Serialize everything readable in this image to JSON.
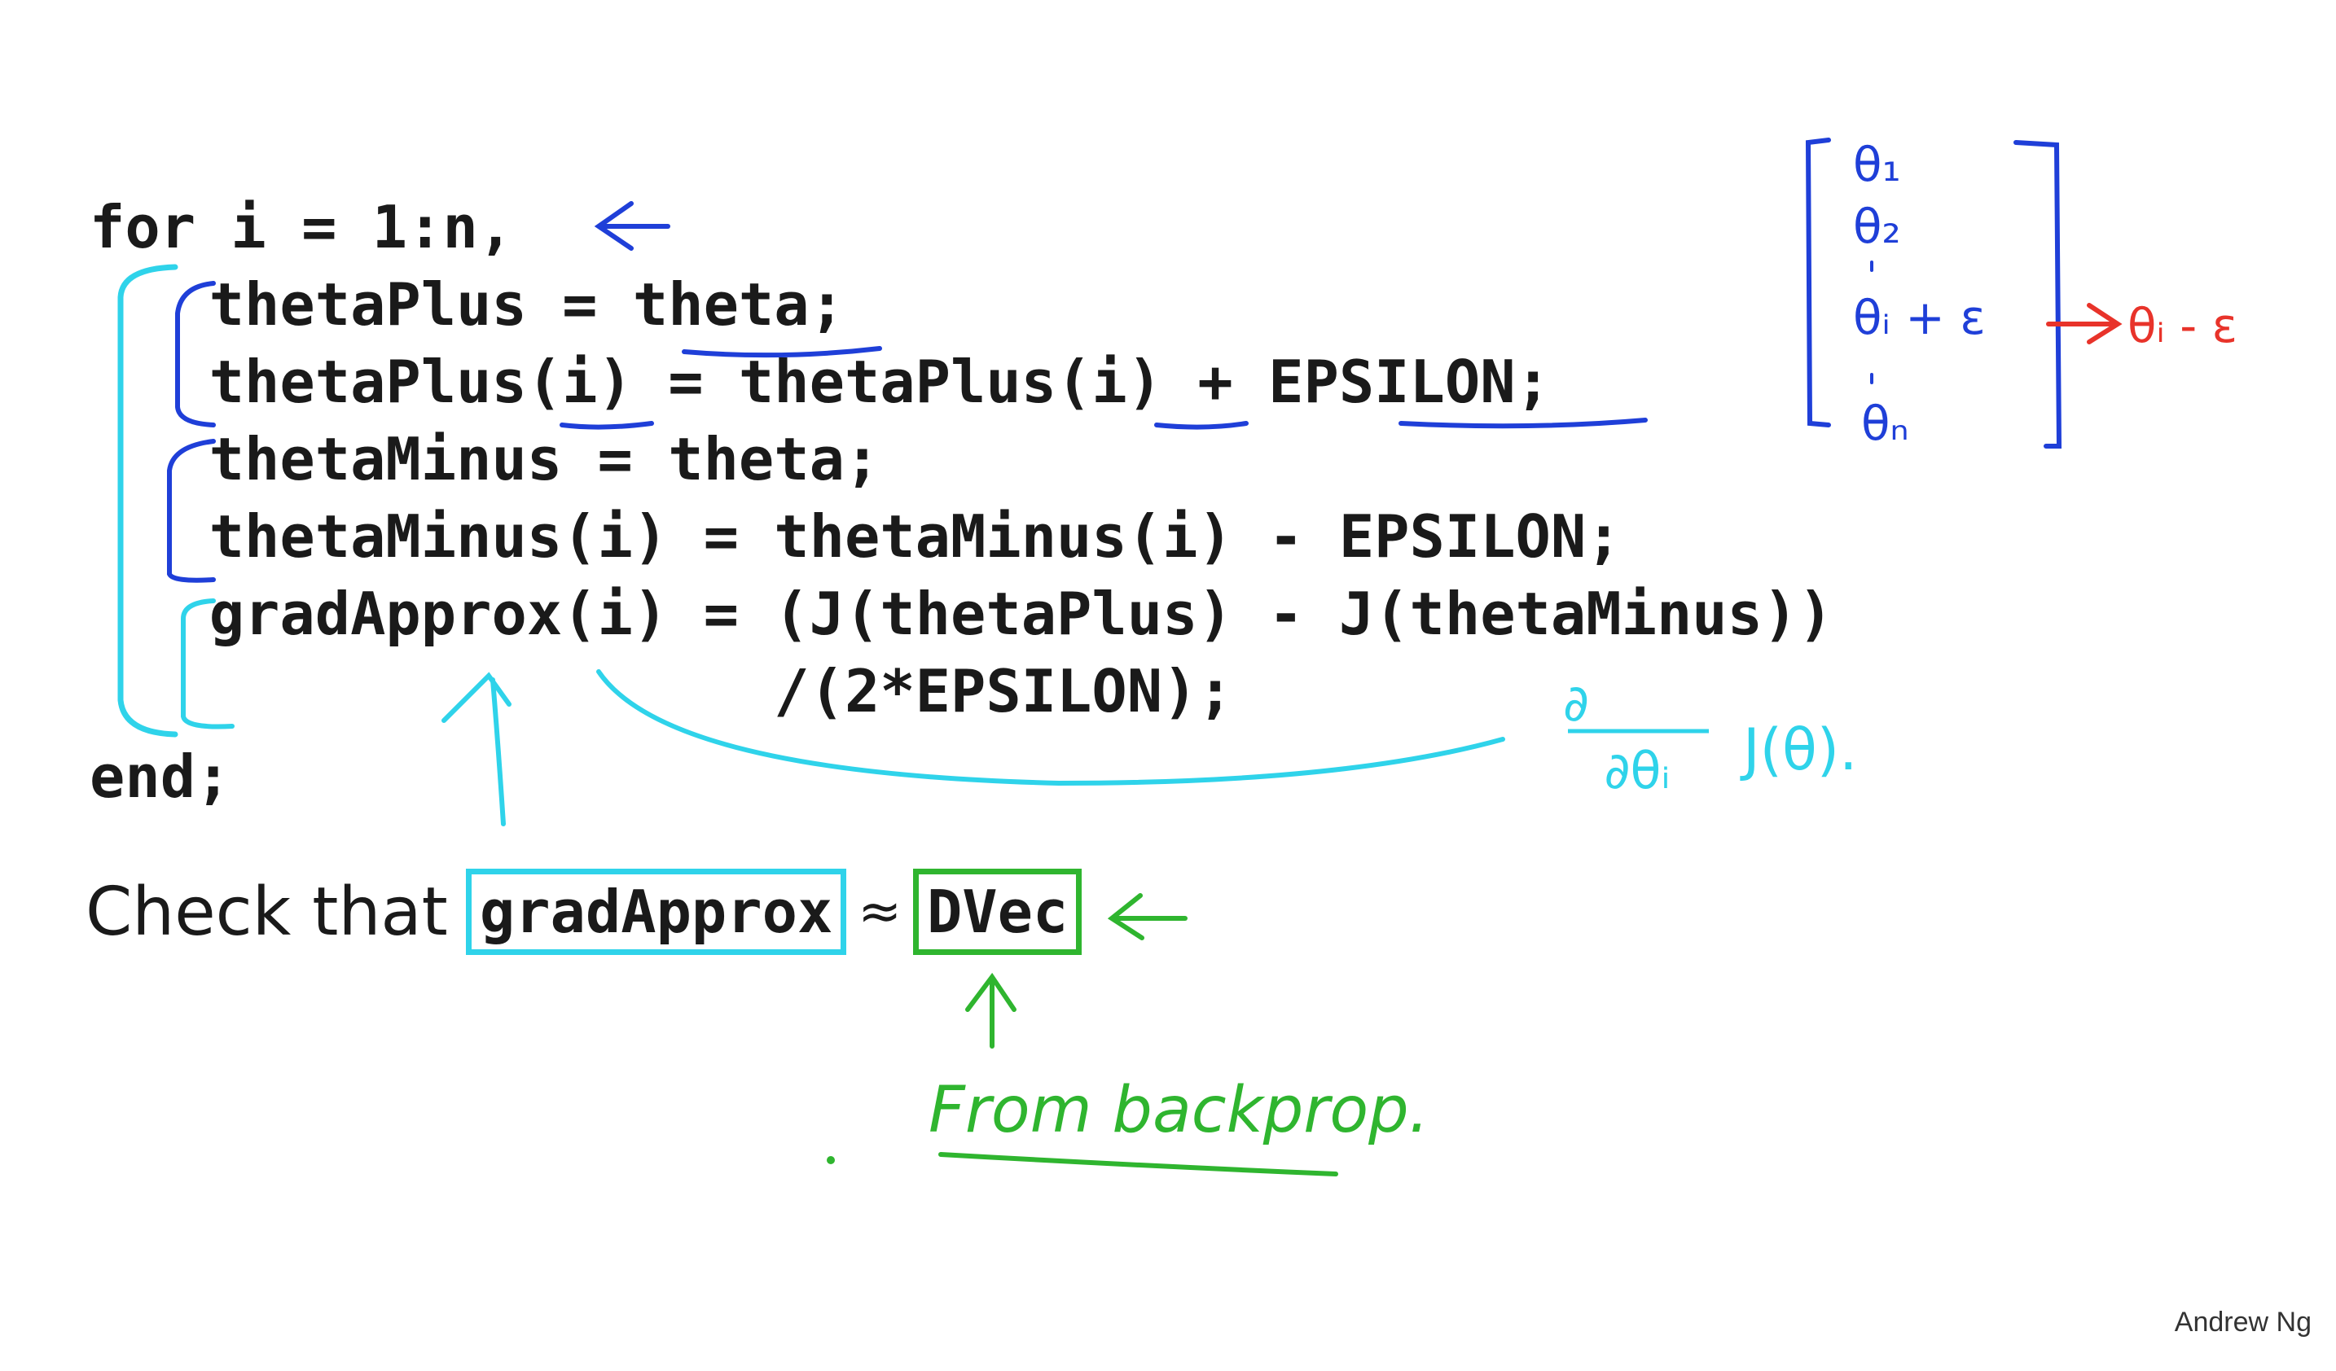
{
  "code": {
    "line1": "for i = 1:n,",
    "line2": "  thetaPlus = theta;",
    "line3": "  thetaPlus(i) = thetaPlus(i) + EPSILON;",
    "line4": "  thetaMinus = theta;",
    "line5": "  thetaMinus(i) = thetaMinus(i) - EPSILON;",
    "line6": "  gradApprox(i) = (J(thetaPlus) - J(thetaMinus))",
    "line7": "                  /(2*EPSILON);",
    "line8": "end;"
  },
  "check": {
    "prefix": "Check that",
    "grad": "gradApprox",
    "approx": "≈",
    "dvec": "DVec"
  },
  "annotations": {
    "theta_1": "θ₁",
    "theta_2": "θ₂",
    "theta_i_plus": "θᵢ + ε",
    "theta_n": "θₙ",
    "theta_i_minus": "θᵢ - ε",
    "partial_num": "∂",
    "partial_den": "∂θᵢ",
    "j_theta": "J(θ).",
    "from_backprop": "From backprop."
  },
  "footer": {
    "author": "Andrew Ng"
  },
  "colors": {
    "ink_blue": "#1f3fd8",
    "ink_cyan": "#2fd3ea",
    "ink_green": "#2fb52f",
    "ink_red": "#e8332a",
    "text": "#1a1a1a"
  }
}
